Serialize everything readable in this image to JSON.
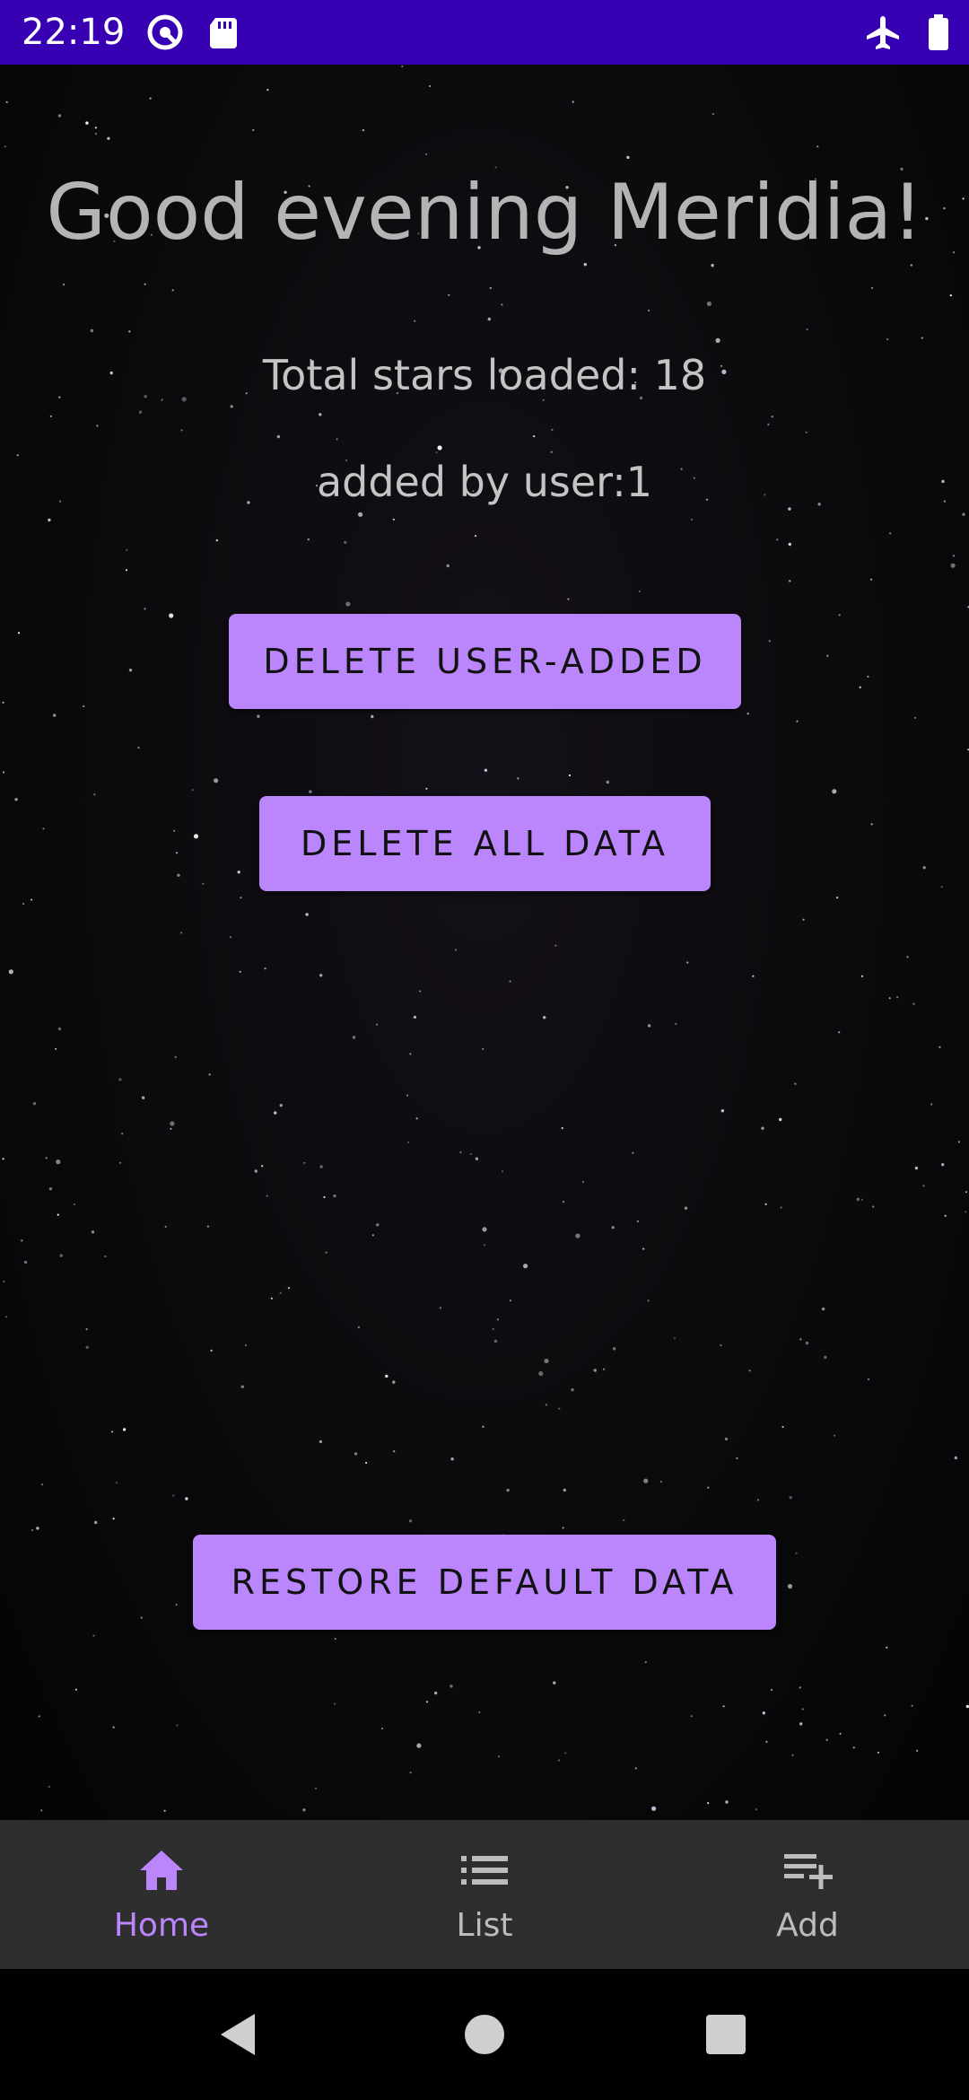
{
  "status_bar": {
    "time": "22:19",
    "left_icons": [
      "vpn-circle-icon",
      "sd-card-icon"
    ],
    "right_icons": [
      "airplane-icon",
      "battery-icon"
    ],
    "background": "#3700b3"
  },
  "main": {
    "greeting": "Good evening Meridia!",
    "total_stars": "Total stars loaded: 18",
    "added_by_user": "added by user:1",
    "buttons": {
      "delete_user_added": "DELETE USER-ADDED",
      "delete_all": "DELETE ALL DATA",
      "restore_default": "RESTORE DEFAULT DATA"
    },
    "button_color": "#bb86fc"
  },
  "bottom_nav": {
    "items": [
      {
        "label": "Home",
        "icon": "home-icon",
        "selected": true
      },
      {
        "label": "List",
        "icon": "list-icon",
        "selected": false
      },
      {
        "label": "Add",
        "icon": "playlist-add-icon",
        "selected": false
      }
    ],
    "active_color": "#bb86fc",
    "inactive_color": "#bdbdbd",
    "background": "#2e2e2e"
  },
  "system_nav": {
    "icons": [
      "back-icon",
      "home-circle-icon",
      "recents-icon"
    ]
  }
}
